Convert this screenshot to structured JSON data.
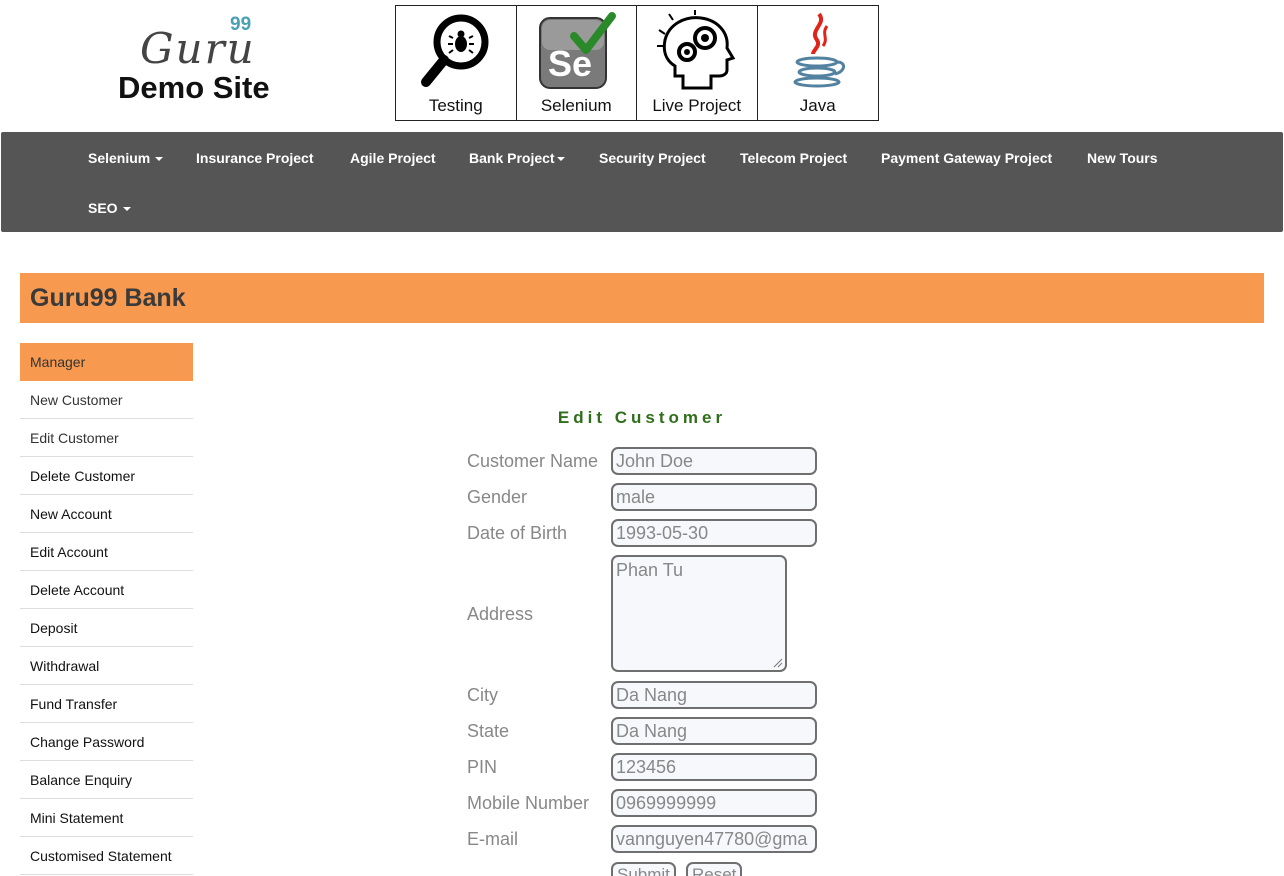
{
  "header": {
    "logo_text": "Guru",
    "logo_superscript": "99",
    "logo_subtitle": "Demo Site",
    "tiles": [
      {
        "label": "Testing",
        "icon": "magnifier-bug-icon"
      },
      {
        "label": "Selenium",
        "icon": "selenium-icon"
      },
      {
        "label": "Live Project",
        "icon": "head-gears-icon"
      },
      {
        "label": "Java",
        "icon": "java-cup-icon"
      }
    ]
  },
  "navbar": {
    "items": [
      {
        "label": "Selenium",
        "dropdown": true
      },
      {
        "label": "Insurance Project",
        "dropdown": false
      },
      {
        "label": "Agile Project",
        "dropdown": false
      },
      {
        "label": "Bank Project",
        "dropdown": true
      },
      {
        "label": "Security Project",
        "dropdown": false
      },
      {
        "label": "Telecom Project",
        "dropdown": false
      },
      {
        "label": "Payment Gateway Project",
        "dropdown": false
      },
      {
        "label": "New Tours",
        "dropdown": false
      },
      {
        "label": "SEO",
        "dropdown": true
      }
    ]
  },
  "bank": {
    "title": "Guru99 Bank"
  },
  "sidebar": {
    "items": [
      {
        "label": "Manager"
      },
      {
        "label": "New Customer"
      },
      {
        "label": "Edit Customer"
      },
      {
        "label": "Delete Customer"
      },
      {
        "label": "New Account"
      },
      {
        "label": "Edit Account"
      },
      {
        "label": "Delete Account"
      },
      {
        "label": "Deposit"
      },
      {
        "label": "Withdrawal"
      },
      {
        "label": "Fund Transfer"
      },
      {
        "label": "Change Password"
      },
      {
        "label": "Balance Enquiry"
      },
      {
        "label": "Mini Statement"
      },
      {
        "label": "Customised Statement"
      }
    ]
  },
  "form": {
    "title": "Edit Customer",
    "fields": {
      "customer_name": {
        "label": "Customer Name",
        "value": "John Doe"
      },
      "gender": {
        "label": "Gender",
        "value": "male"
      },
      "dob": {
        "label": "Date of Birth",
        "value": "1993-05-30"
      },
      "address": {
        "label": "Address",
        "value": "Phan Tu"
      },
      "city": {
        "label": "City",
        "value": "Da Nang"
      },
      "state": {
        "label": "State",
        "value": "Da Nang"
      },
      "pin": {
        "label": "PIN",
        "value": "123456"
      },
      "mobile": {
        "label": "Mobile Number",
        "value": "0969999999"
      },
      "email": {
        "label": "E-mail",
        "value": "vannguyen47780@gma"
      }
    },
    "submit_label": "Submit",
    "reset_label": "Reset"
  },
  "colors": {
    "accent": "#f79a4f",
    "navbar": "#555555",
    "form_title": "#2f6f1a"
  }
}
